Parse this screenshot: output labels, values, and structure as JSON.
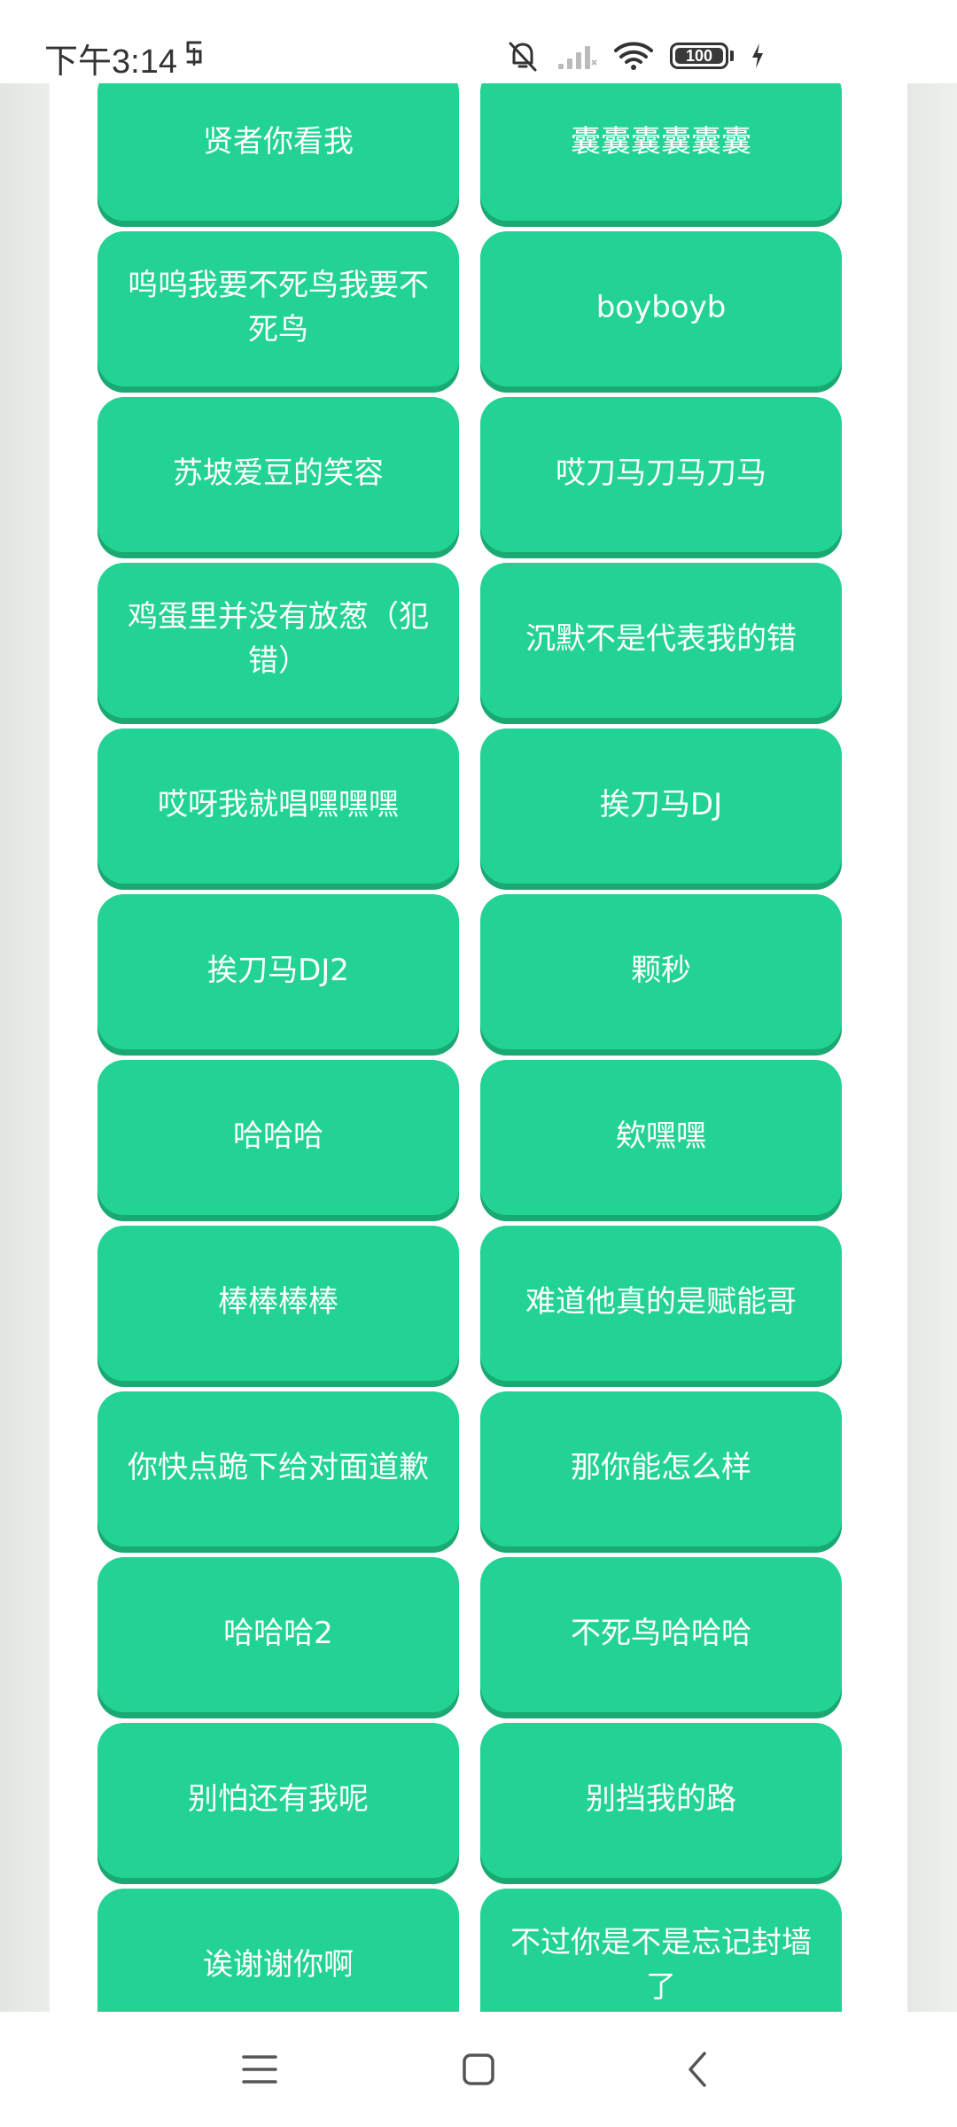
{
  "status_bar": {
    "time": "下午3:14",
    "battery_level": "100"
  },
  "sound_buttons": [
    {
      "label": "贤者你看我"
    },
    {
      "label": "囊囊囊囊囊囊"
    },
    {
      "label": "呜呜我要不死鸟我要不死鸟"
    },
    {
      "label": "boyboyb"
    },
    {
      "label": "苏坡爱豆的笑容"
    },
    {
      "label": "哎刀马刀马刀马"
    },
    {
      "label": "鸡蛋里并没有放葱（犯错）"
    },
    {
      "label": "沉默不是代表我的错"
    },
    {
      "label": "哎呀我就唱嘿嘿嘿"
    },
    {
      "label": "挨刀马DJ"
    },
    {
      "label": "挨刀马DJ2"
    },
    {
      "label": "颗秒"
    },
    {
      "label": "哈哈哈"
    },
    {
      "label": "欸嘿嘿"
    },
    {
      "label": "棒棒棒棒"
    },
    {
      "label": "难道他真的是赋能哥"
    },
    {
      "label": "你快点跪下给对面道歉"
    },
    {
      "label": "那你能怎么样"
    },
    {
      "label": "哈哈哈2"
    },
    {
      "label": "不死鸟哈哈哈"
    },
    {
      "label": "别怕还有我呢"
    },
    {
      "label": "别挡我的路"
    },
    {
      "label": "诶谢谢你啊"
    },
    {
      "label": "不过你是不是忘记封墙了"
    }
  ],
  "colors": {
    "button": "#22d394",
    "button_shadow": "#1aa873",
    "side_strip": "#e6e8e6"
  },
  "icons": {
    "status": [
      "eye-care-icon",
      "mute-icon",
      "signal-icon",
      "wifi-icon",
      "battery-icon",
      "charging-icon"
    ],
    "nav": [
      "menu-icon",
      "home-icon",
      "back-icon"
    ]
  }
}
